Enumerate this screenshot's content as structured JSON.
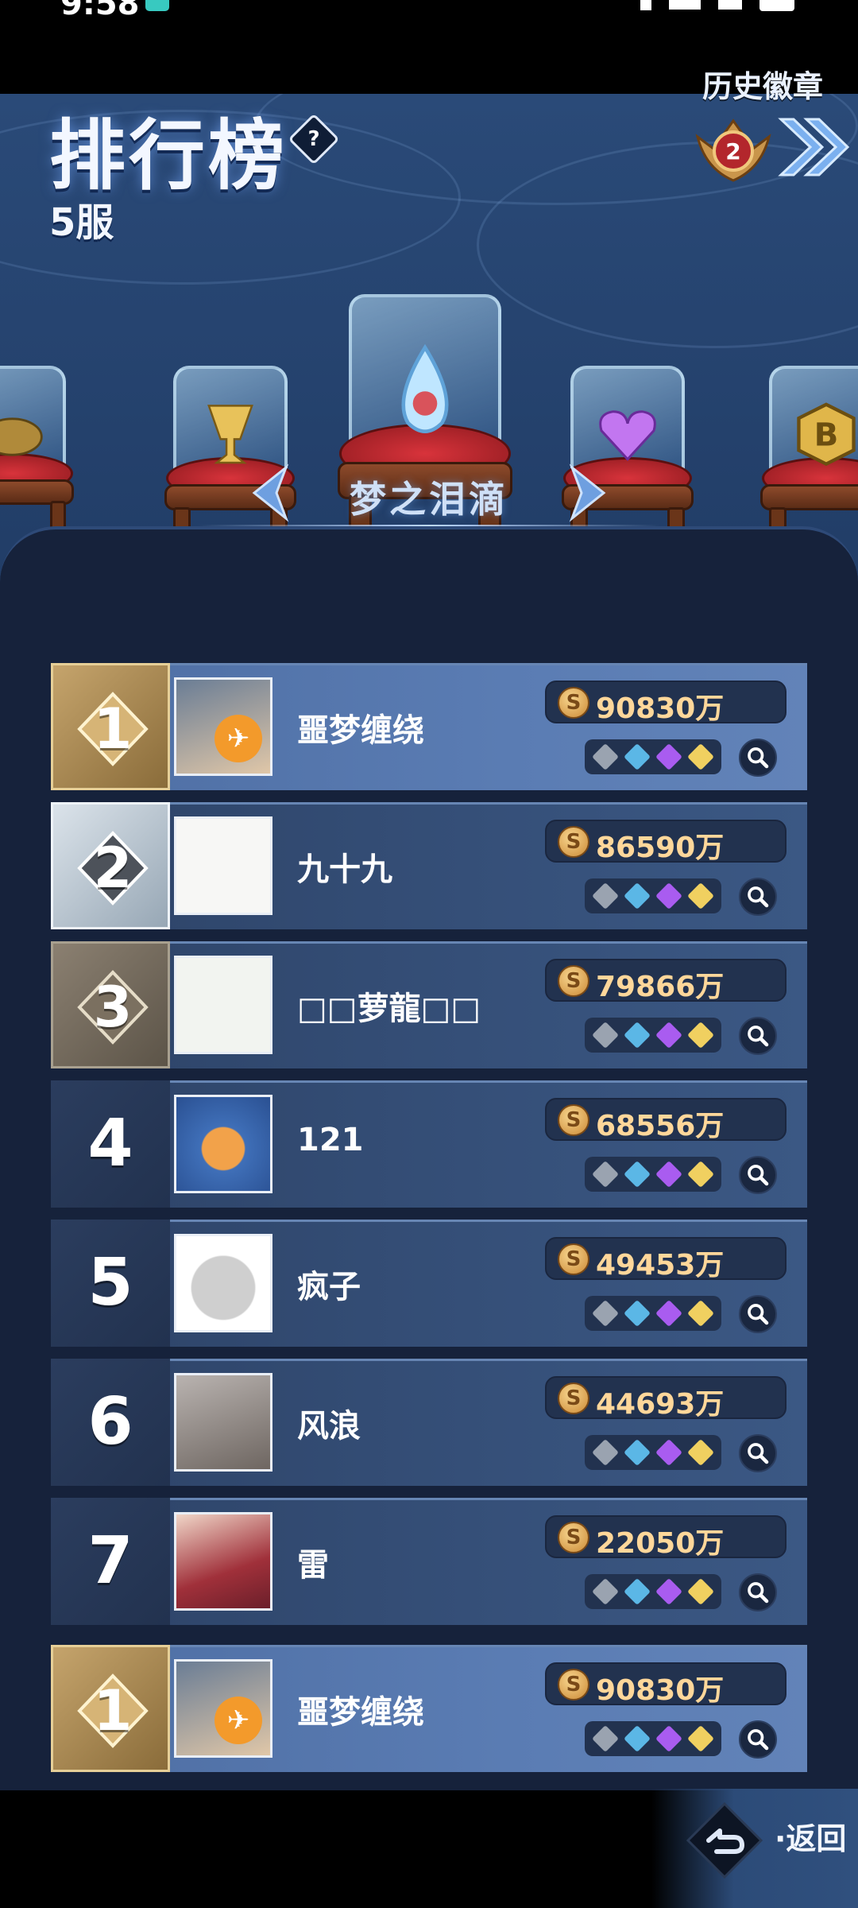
{
  "status_bar": {
    "time": "9:58"
  },
  "header": {
    "title": "排行榜",
    "help_glyph": "?",
    "server": "5服",
    "history_label": "历史徽章",
    "history_badge_number": "2"
  },
  "carousel": {
    "label": "梦之泪滴",
    "items": [
      "turtle-trophy",
      "golden-cup-trophy",
      "crystal-teardrop",
      "winged-heart-gem",
      "b-coin"
    ]
  },
  "leaderboard": {
    "currency_glyph": "S",
    "rows": [
      {
        "rank": "1",
        "name": "噩梦缠绕",
        "score": "90830万"
      },
      {
        "rank": "2",
        "name": "九十九",
        "score": "86590万"
      },
      {
        "rank": "3",
        "name": "□□萝龍□□",
        "score": "79866万"
      },
      {
        "rank": "4",
        "name": "121",
        "score": "68556万"
      },
      {
        "rank": "5",
        "name": "疯子",
        "score": "49453万"
      },
      {
        "rank": "6",
        "name": "风浪",
        "score": "44693万"
      },
      {
        "rank": "7",
        "name": "雷",
        "score": "22050万"
      }
    ],
    "self_row": {
      "rank": "1",
      "name": "噩梦缠绕",
      "score": "90830万"
    }
  },
  "footer": {
    "back_label": "·返回"
  },
  "colors": {
    "gold": "#c5a46c",
    "silver": "#dbe3ea",
    "bronze": "#8b8071",
    "score_text": "#ffd79a",
    "gem_gray": "#9aa3b0",
    "gem_blue": "#5bb7e6",
    "gem_purple": "#a95cf0",
    "gem_yellow": "#f0d060"
  }
}
